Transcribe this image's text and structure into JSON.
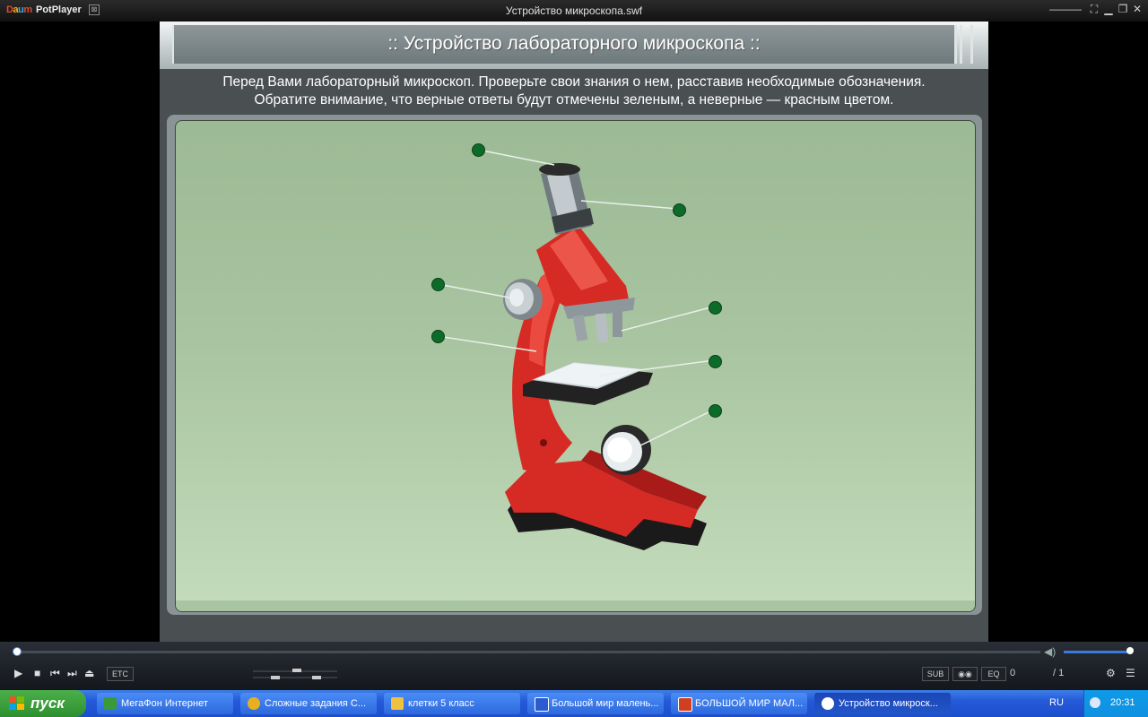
{
  "titlebar": {
    "logo": [
      "D",
      "a",
      "u",
      "m"
    ],
    "app_name": "PotPlayer",
    "window_title": "Устройство микроскопа.swf"
  },
  "flash": {
    "title": ":: Устройство лабораторного микроскопа ::",
    "instruction_line1": "Перед Вами лабораторный микроскоп. Проверьте свои знания о нем, расставив необходимые обозначения.",
    "instruction_line2": "Обратите внимание, что верные ответы будут отмечены зеленым, а неверные — красным цветом.",
    "marker_color": "#0d6b2a",
    "microscope_color": "#d62a25"
  },
  "player": {
    "etc_label": "ETC",
    "sub_label": "SUB",
    "eq_label": "EQ",
    "counter": "0",
    "total": "/ 1",
    "progress": 0.0,
    "volume": 0.95
  },
  "taskbar": {
    "start_label": "пуск",
    "tasks": [
      {
        "label": "МегаФон Интернет",
        "icon_color": "#3a9a3a"
      },
      {
        "label": "Сложные задания С...",
        "icon_color": "#e8b020"
      },
      {
        "label": "клетки 5 класс",
        "icon_color": "#f0c040"
      },
      {
        "label": "Большой мир малень...",
        "icon_color": "#2a5bd0"
      },
      {
        "label": "БОЛЬШОЙ МИР МАЛ...",
        "icon_color": "#d04020"
      },
      {
        "label": "Устройство микроск...",
        "icon_color": "#ffffff"
      }
    ],
    "lang": "RU",
    "clock": "20:31"
  }
}
